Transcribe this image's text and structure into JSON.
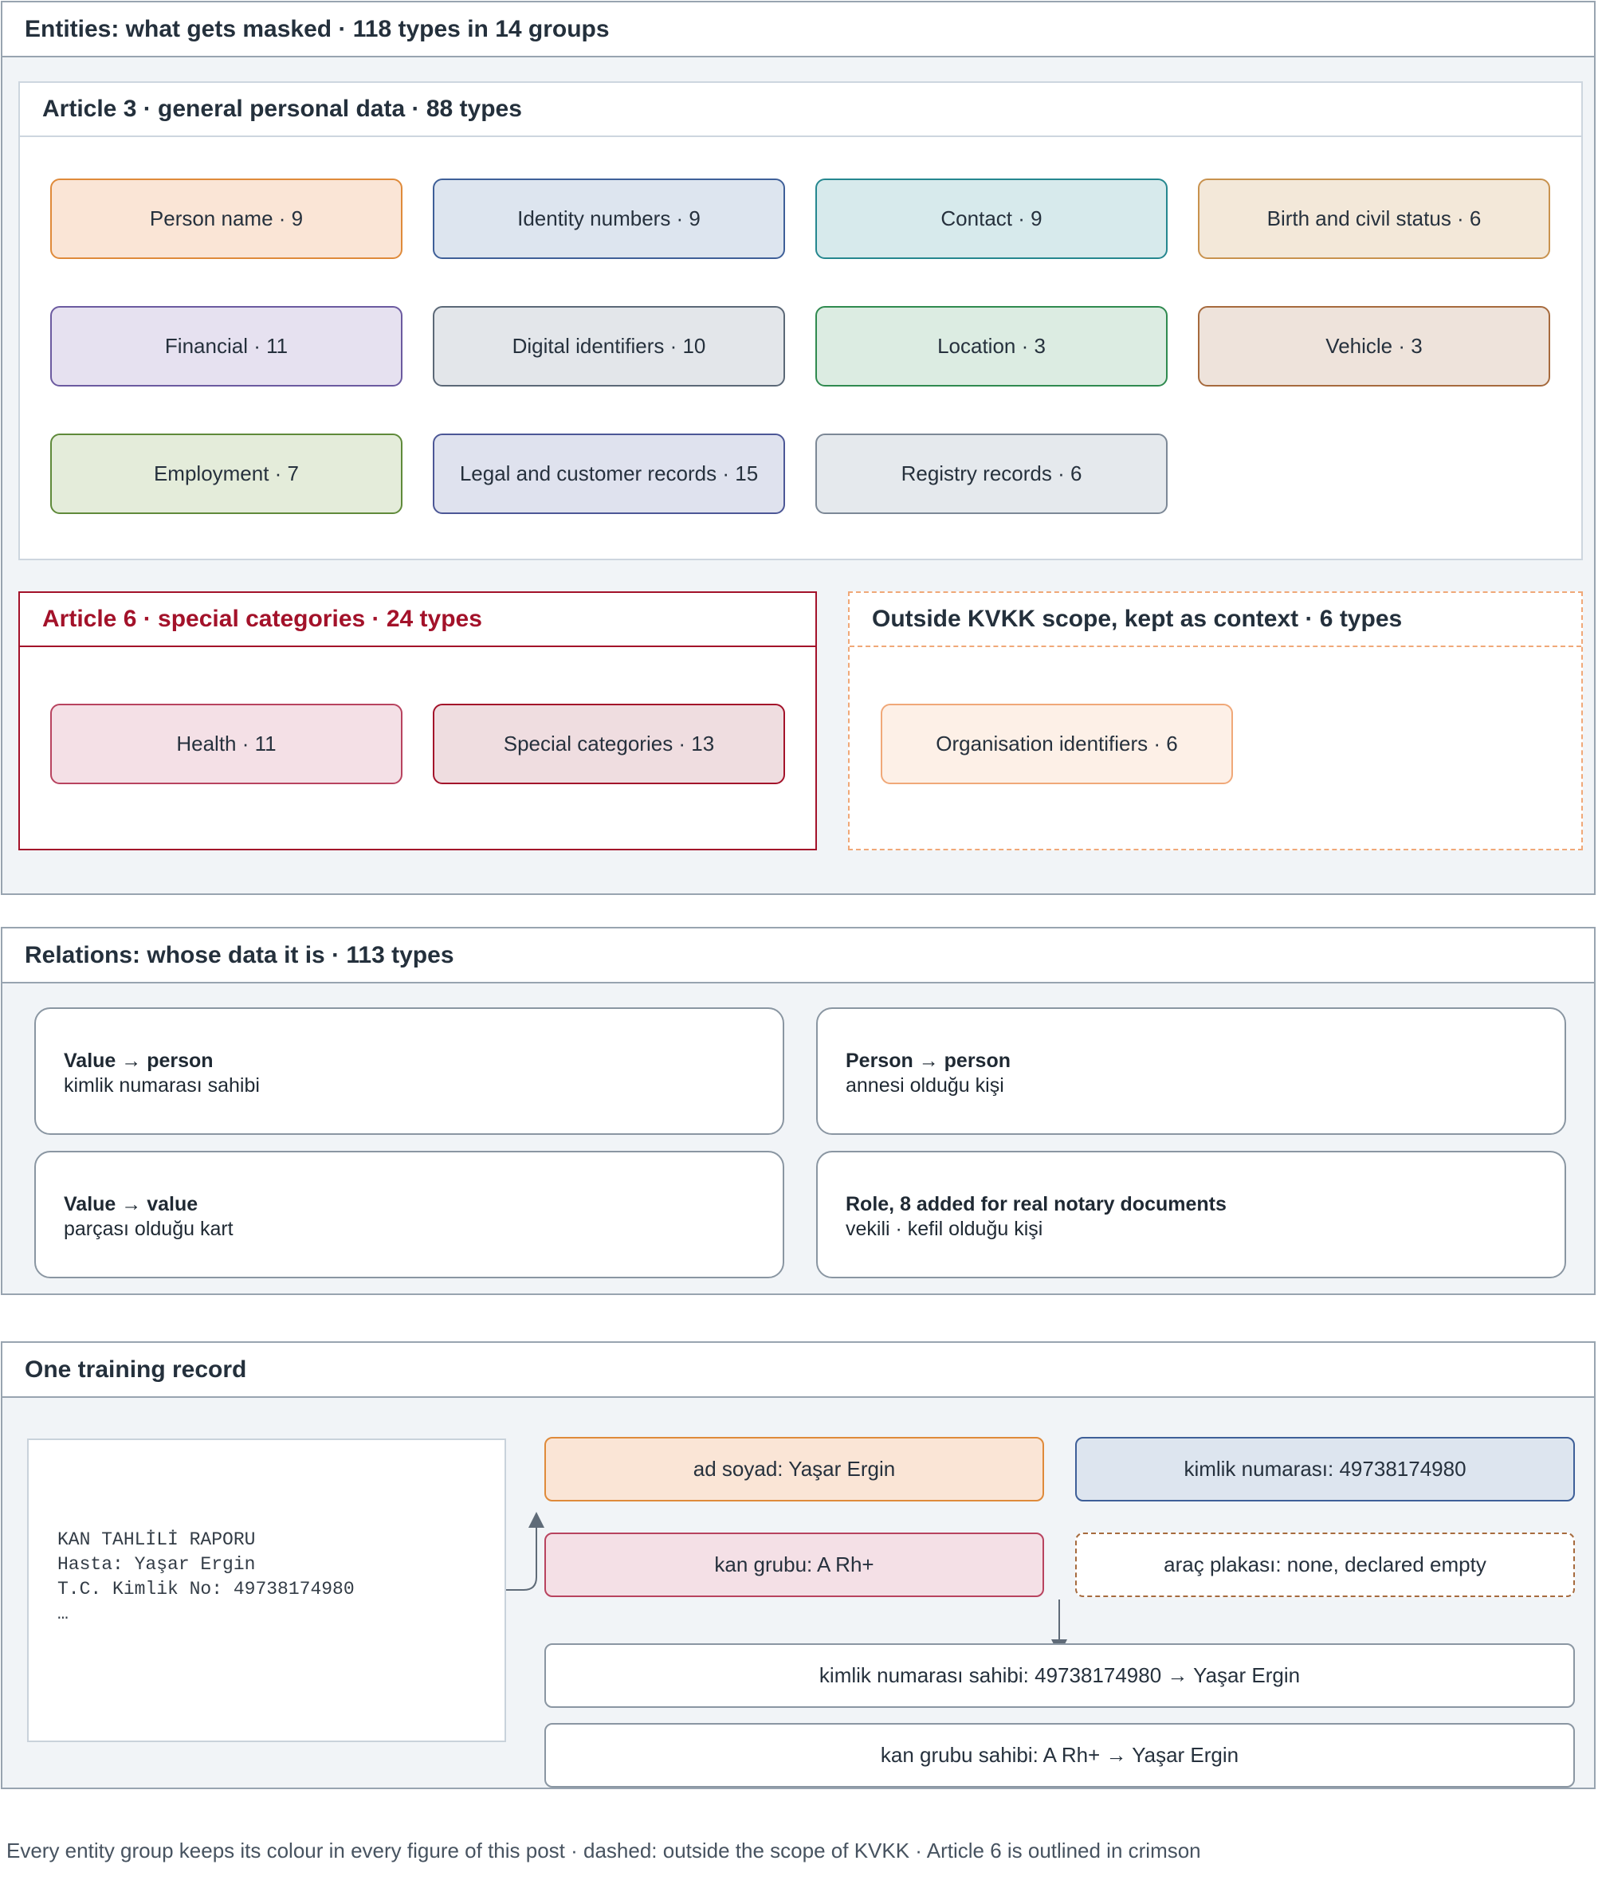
{
  "entities": {
    "title": "Entities: what gets masked · 118 types in 14 groups",
    "article3": {
      "title": "Article 3 · general personal data · 88 types",
      "groups": [
        {
          "label": "Person name · 9",
          "fill": "#fae5d6",
          "border": "#df8a3a"
        },
        {
          "label": "Identity numbers · 9",
          "fill": "#dde5ef",
          "border": "#3e5f98"
        },
        {
          "label": "Contact · 9",
          "fill": "#d7eaec",
          "border": "#25878f"
        },
        {
          "label": "Birth and civil status · 6",
          "fill": "#f3e8d9",
          "border": "#c8924e"
        },
        {
          "label": "Financial · 11",
          "fill": "#e6e1f0",
          "border": "#6b5aa0"
        },
        {
          "label": "Digital identifiers · 10",
          "fill": "#e3e6ea",
          "border": "#5b6877"
        },
        {
          "label": "Location · 3",
          "fill": "#dcece2",
          "border": "#2f8a4f"
        },
        {
          "label": "Vehicle · 3",
          "fill": "#eee3db",
          "border": "#a66a3d"
        },
        {
          "label": "Employment · 7",
          "fill": "#e4ecda",
          "border": "#5f8a3a"
        },
        {
          "label": "Legal and customer records · 15",
          "fill": "#dfe2ee",
          "border": "#4c5796"
        },
        {
          "label": "Registry records · 6",
          "fill": "#e5e9ed",
          "border": "#7c8896"
        }
      ]
    },
    "article6": {
      "title": "Article 6 · special categories · 24 types",
      "groups": [
        {
          "label": "Health · 11",
          "fill": "#f4e0e6",
          "border": "#b8435f"
        },
        {
          "label": "Special categories · 13",
          "fill": "#efdde0",
          "border": "#a3122a"
        }
      ]
    },
    "outside": {
      "title": "Outside KVKK scope, kept as context · 6 types",
      "groups": [
        {
          "label": "Organisation identifiers · 6",
          "fill": "#fdf0e7",
          "border": "#f0a878"
        }
      ]
    }
  },
  "relations": {
    "title": "Relations: whose data it is · 113 types",
    "items": [
      {
        "type": "Value → person",
        "example": "kimlik numarası sahibi"
      },
      {
        "type": "Person → person",
        "example": "annesi olduğu kişi"
      },
      {
        "type": "Value → value",
        "example": "parçası olduğu kart"
      },
      {
        "type": "Role, 8 added for real notary documents",
        "example": "vekili · kefil olduğu kişi"
      }
    ]
  },
  "record": {
    "title": "One training record",
    "document_lines": [
      "KAN TAHLİLİ RAPORU",
      "",
      "Hasta: Yaşar Ergin",
      "T.C. Kimlik No: 49738174980",
      "…"
    ],
    "entities": [
      {
        "label": "ad soyad: Yaşar Ergin",
        "fill": "#fae5d6",
        "border": "#df8a3a"
      },
      {
        "label": "kimlik numarası: 49738174980",
        "fill": "#dde5ef",
        "border": "#3e5f98"
      },
      {
        "label": "kan grubu: A Rh+",
        "fill": "#f4e0e6",
        "border": "#b8435f"
      },
      {
        "label": "araç plakası: none, declared empty",
        "fill": "#ffffff",
        "border": "#a66a3d"
      }
    ],
    "relations": [
      "kimlik numarası sahibi: 49738174980 → Yaşar Ergin",
      "kan grubu sahibi: A Rh+ → Yaşar Ergin"
    ]
  },
  "footnote": "Every entity group keeps its colour in every figure of this post · dashed: outside the scope of KVKK · Article 6 is outlined in crimson"
}
